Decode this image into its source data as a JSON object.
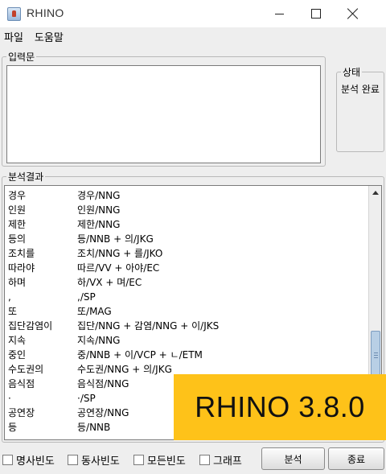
{
  "window": {
    "title": "RHINO"
  },
  "menu": {
    "file": "파일",
    "help": "도움말"
  },
  "input": {
    "legend": "입력문",
    "value": ""
  },
  "status": {
    "legend": "상태",
    "text": "분석 완료"
  },
  "results": {
    "legend": "분석결과",
    "rows": [
      {
        "word": "경우",
        "analysis": "경우/NNG"
      },
      {
        "word": "인원",
        "analysis": "인원/NNG"
      },
      {
        "word": "제한",
        "analysis": "제한/NNG"
      },
      {
        "word": "등의",
        "analysis": "등/NNB + 의/JKG"
      },
      {
        "word": "조치를",
        "analysis": "조치/NNG + 를/JKO"
      },
      {
        "word": "따라야",
        "analysis": "따르/VV + 아야/EC"
      },
      {
        "word": "하며",
        "analysis": "하/VX + 며/EC"
      },
      {
        "word": ",",
        "analysis": ",/SP"
      },
      {
        "word": "또",
        "analysis": "또/MAG"
      },
      {
        "word": "집단감염이",
        "analysis": "집단/NNG + 감염/NNG + 이/JKS"
      },
      {
        "word": "지속",
        "analysis": "지속/NNG"
      },
      {
        "word": "중인",
        "analysis": "중/NNB + 이/VCP + ㄴ/ETM"
      },
      {
        "word": "수도권의",
        "analysis": "수도권/NNG + 의/JKG"
      },
      {
        "word": "음식점",
        "analysis": "음식점/NNG"
      },
      {
        "word": "·",
        "analysis": "·/SP"
      },
      {
        "word": "공연장",
        "analysis": "공연장/NNG"
      },
      {
        "word": "등",
        "analysis": "등/NNB"
      }
    ]
  },
  "banner": {
    "text": "RHINO 3.8.0",
    "color": "#fec219"
  },
  "controls": {
    "noun_freq": "명사빈도",
    "verb_freq": "동사빈도",
    "all_freq": "모든빈도",
    "graph": "그래프",
    "analyze": "분석",
    "exit": "종료"
  }
}
